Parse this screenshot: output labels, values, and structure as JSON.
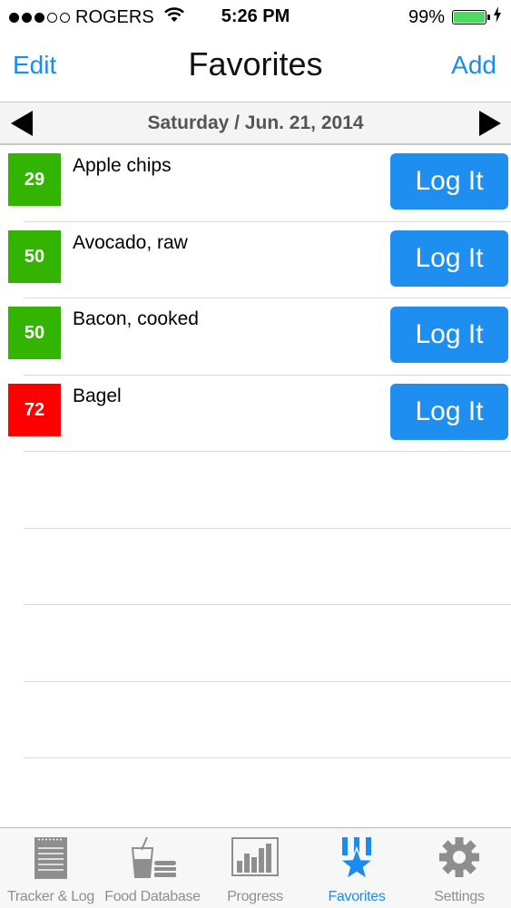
{
  "status_bar": {
    "carrier": "ROGERS",
    "time": "5:26 PM",
    "battery_percent": "99%",
    "signal_bars_filled": 3,
    "signal_bars_total": 5,
    "battery_level": 0.99
  },
  "nav": {
    "edit_label": "Edit",
    "title": "Favorites",
    "add_label": "Add"
  },
  "date_bar": {
    "date": "Saturday / Jun. 21, 2014"
  },
  "favorites": [
    {
      "score": "29",
      "name": "Apple chips",
      "color": "#33b400",
      "button_label": "Log It"
    },
    {
      "score": "50",
      "name": "Avocado, raw",
      "color": "#33b400",
      "button_label": "Log It"
    },
    {
      "score": "50",
      "name": "Bacon, cooked",
      "color": "#33b400",
      "button_label": "Log It"
    },
    {
      "score": "72",
      "name": "Bagel",
      "color": "#ff0000",
      "button_label": "Log It"
    }
  ],
  "tabs": [
    {
      "label": "Tracker & Log",
      "icon": "notepad-icon",
      "active": false
    },
    {
      "label": "Food Database",
      "icon": "drink-burger-icon",
      "active": false
    },
    {
      "label": "Progress",
      "icon": "bar-chart-icon",
      "active": false
    },
    {
      "label": "Favorites",
      "icon": "star-ribbon-icon",
      "active": true
    },
    {
      "label": "Settings",
      "icon": "gear-icon",
      "active": false
    }
  ],
  "colors": {
    "accent": "#1a8cf0",
    "button": "#1f8ef1",
    "score_green": "#33b400",
    "score_red": "#ff0000",
    "battery_green": "#4cd964"
  }
}
